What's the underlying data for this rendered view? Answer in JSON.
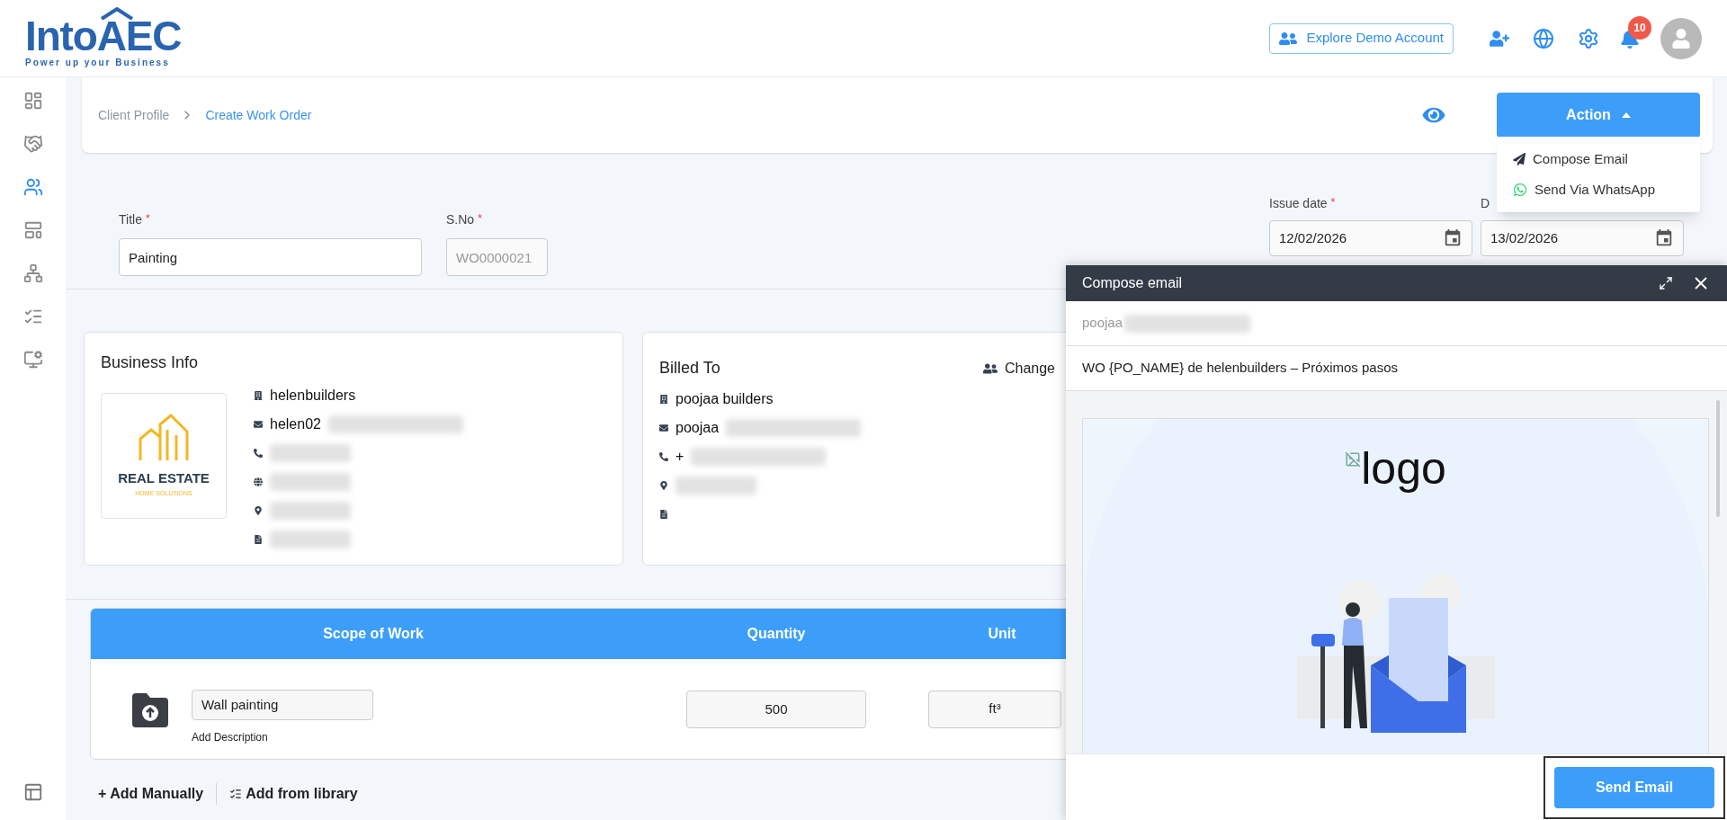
{
  "logo": {
    "name": "IntoAEC",
    "tagline": "Power up your Business"
  },
  "header": {
    "demo_button": "Explore Demo Account",
    "notifications": "10"
  },
  "sidebar": {
    "items": [
      {
        "selected": false
      },
      {
        "selected": false
      },
      {
        "selected": true
      },
      {
        "selected": false
      },
      {
        "selected": false
      },
      {
        "selected": false
      },
      {
        "selected": false
      }
    ]
  },
  "breadcrumb": [
    {
      "label": "Client Profile",
      "selected": false
    },
    {
      "label": "Create Work Order",
      "selected": true
    }
  ],
  "action_button": {
    "label": "Action",
    "expanded": true
  },
  "action_menu": [
    {
      "kind": "email",
      "label": "Compose Email"
    },
    {
      "kind": "whatsapp",
      "label": "Send Via WhatsApp"
    }
  ],
  "form": {
    "fields": [
      {
        "label": "Title",
        "required_mark": "*",
        "value": "Painting"
      },
      {
        "label": "S.No",
        "required_mark": "*",
        "placeholder": "WO0000021"
      }
    ],
    "dates": [
      {
        "label": "Issue date",
        "required_mark": "*",
        "value": "12/02/2026"
      },
      {
        "label": "D",
        "value": "13/02/2026"
      }
    ]
  },
  "business_info": {
    "title": "Business Info",
    "logo_text": "REAL ESTATE",
    "logo_subtext": "HOME SOLUTIONS",
    "rows": [
      {
        "kind": "company",
        "text": "helenbuilders",
        "blurred": false
      },
      {
        "kind": "email",
        "text": "helen02",
        "blurred": true
      },
      {
        "kind": "phone",
        "blurred": true
      },
      {
        "kind": "website",
        "blurred": true
      },
      {
        "kind": "address",
        "blurred": true
      },
      {
        "kind": "tax",
        "blurred": true
      }
    ]
  },
  "billed_to": {
    "title": "Billed To",
    "change_label": "Change",
    "rows": [
      {
        "kind": "company",
        "text": "poojaa builders",
        "blurred": false
      },
      {
        "kind": "email",
        "text": "poojaa",
        "blurred": true
      },
      {
        "kind": "phone",
        "text": "+",
        "blurred": true
      },
      {
        "kind": "address",
        "blurred": true
      },
      {
        "kind": "tax",
        "blurred": false
      }
    ]
  },
  "table": {
    "columns": [
      "Scope of Work",
      "Quantity",
      "Unit"
    ],
    "rows": [
      {
        "scope": "Wall painting",
        "description_link": "Add Description",
        "quantity": "500",
        "unit": "ft³"
      }
    ]
  },
  "table_actions": [
    {
      "kind": "manual",
      "label": "+ Add Manually"
    },
    {
      "kind": "library",
      "label": "Add from library"
    }
  ],
  "compose_email": {
    "title": "Compose email",
    "to": "poojaa",
    "to_blurred": true,
    "subject": "WO {PO_NAME} de helenbuilders – Próximos pasos",
    "logo_alt": "logo",
    "send_button": "Send Email",
    "send_focused": true
  }
}
